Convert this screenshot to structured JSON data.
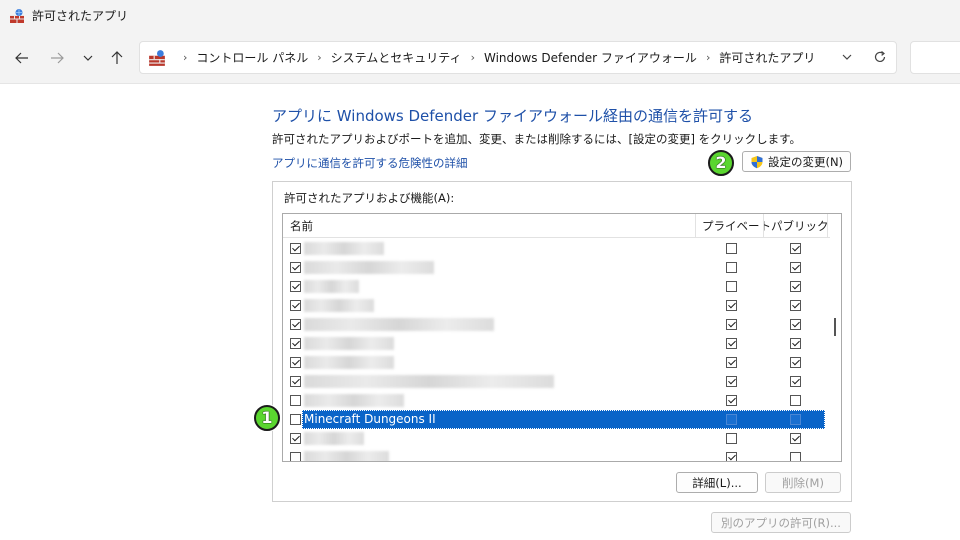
{
  "window": {
    "title": "許可されたアプリ"
  },
  "breadcrumbs": [
    "コントロール パネル",
    "システムとセキュリティ",
    "Windows Defender ファイアウォール",
    "許可されたアプリ"
  ],
  "page": {
    "heading": "アプリに Windows Defender ファイアウォール経由の通信を許可する",
    "description": "許可されたアプリおよびポートを追加、変更、または削除するには、[設定の変更] をクリックします。",
    "risk_link": "アプリに通信を許可する危険性の詳細",
    "change_settings_label": "設定の変更(N)",
    "group_label": "許可されたアプリおよび機能(A):",
    "columns": {
      "name": "名前",
      "private": "プライベート",
      "public": "パブリック"
    },
    "details_button": "詳細(L)...",
    "remove_button": "削除(M)",
    "allow_another_button": "別のアプリの許可(R)..."
  },
  "apps": [
    {
      "name": "",
      "enabled": true,
      "private": false,
      "public": true,
      "blur_width": 80
    },
    {
      "name": "",
      "enabled": true,
      "private": false,
      "public": true,
      "blur_width": 130
    },
    {
      "name": "",
      "enabled": true,
      "private": false,
      "public": true,
      "blur_width": 55
    },
    {
      "name": "",
      "enabled": true,
      "private": true,
      "public": true,
      "blur_width": 70
    },
    {
      "name": "",
      "enabled": true,
      "private": true,
      "public": true,
      "blur_width": 190
    },
    {
      "name": "",
      "enabled": true,
      "private": true,
      "public": true,
      "blur_width": 90
    },
    {
      "name": "",
      "enabled": true,
      "private": true,
      "public": true,
      "blur_width": 90
    },
    {
      "name": "",
      "enabled": true,
      "private": true,
      "public": true,
      "blur_width": 250
    },
    {
      "name": "",
      "enabled": false,
      "private": true,
      "public": false,
      "blur_width": 100
    },
    {
      "name": "Minecraft Dungeons II",
      "enabled": false,
      "private": false,
      "public": false,
      "selected": true
    },
    {
      "name": "",
      "enabled": true,
      "private": false,
      "public": true,
      "blur_width": 60
    },
    {
      "name": "",
      "enabled": false,
      "private": true,
      "public": false,
      "blur_width": 85
    }
  ],
  "annotations": {
    "step1": "1",
    "step2": "2"
  },
  "colors": {
    "link": "#1e50a8",
    "selection": "#0a64c8",
    "badge": "#5ad62f"
  },
  "icons": [
    "firewall-icon",
    "back-arrow-icon",
    "forward-arrow-icon",
    "recent-dropdown-icon",
    "up-arrow-icon",
    "chevron-down-icon",
    "refresh-icon",
    "uac-shield-icon"
  ]
}
